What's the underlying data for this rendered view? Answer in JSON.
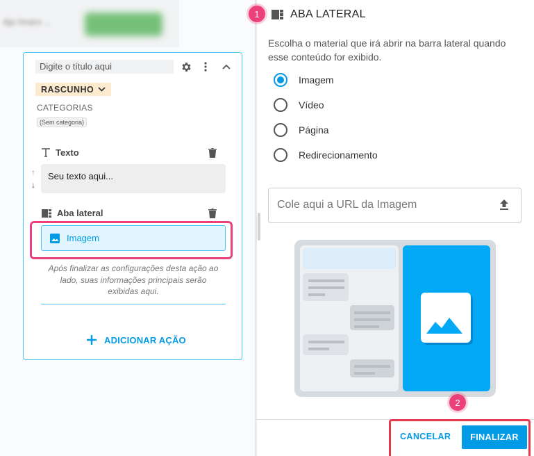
{
  "background": {
    "blurred_text": "Ajo hnaro ..."
  },
  "card": {
    "title_placeholder": "Digite o título aqui",
    "status_label": "RASCUNHO",
    "categories_label": "CATEGORIAS",
    "category_chip": "(Sem categoria)",
    "text_section_label": "Texto",
    "text_content": "Seu texto aqui...",
    "sidebar_section_label": "Aba lateral",
    "selected_option_label": "Imagem",
    "hint": "Após finalizar as configurações desta ação ao lado, suas informações principais serão exibidas aqui.",
    "add_action_label": "ADICIONAR AÇÃO"
  },
  "panel": {
    "step1": "1",
    "title": "ABA LATERAL",
    "description": "Escolha o material que irá abrir na barra lateral quando esse conteúdo for exibido.",
    "options": [
      {
        "label": "Imagem",
        "selected": true
      },
      {
        "label": "Vídeo",
        "selected": false
      },
      {
        "label": "Página",
        "selected": false
      },
      {
        "label": "Redirecionamento",
        "selected": false
      }
    ],
    "url_placeholder": "Cole aqui a URL da Imagem",
    "step2": "2",
    "cancel_label": "CANCELAR",
    "finalize_label": "FINALIZAR"
  },
  "colors": {
    "accent": "#039be5",
    "highlight": "#e91e63",
    "draft_bg": "#fdebd0"
  }
}
